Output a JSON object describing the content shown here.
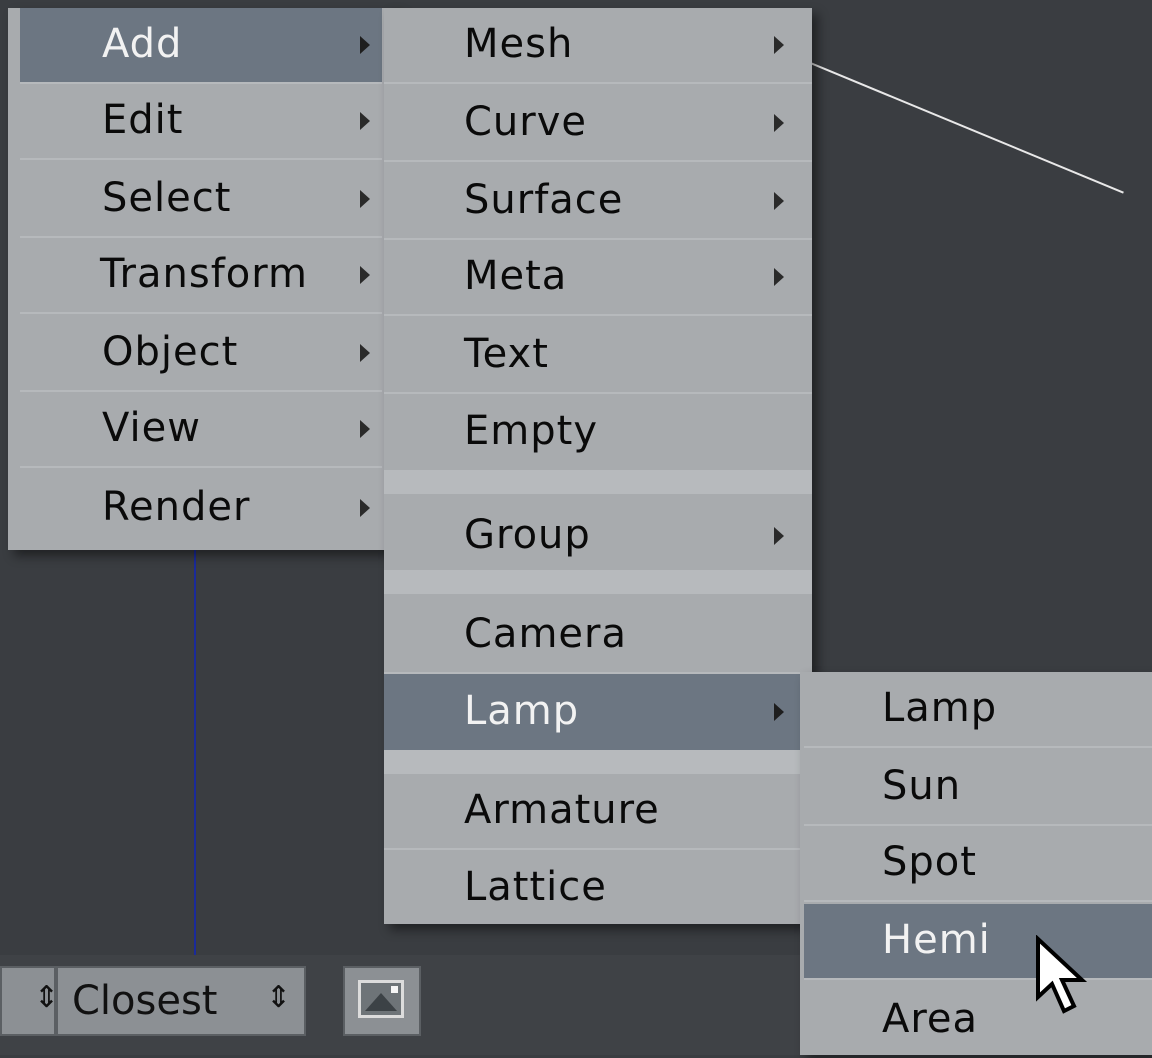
{
  "main_menu": {
    "items": [
      {
        "label": "Add",
        "has_submenu": true,
        "active": true
      },
      {
        "label": "Edit",
        "has_submenu": true
      },
      {
        "label": "Select",
        "has_submenu": true
      },
      {
        "label": "Transform",
        "has_submenu": true
      },
      {
        "label": "Object",
        "has_submenu": true
      },
      {
        "label": "View",
        "has_submenu": true
      },
      {
        "label": "Render",
        "has_submenu": true
      }
    ]
  },
  "add_menu": {
    "items": [
      {
        "label": "Mesh",
        "has_submenu": true
      },
      {
        "label": "Curve",
        "has_submenu": true
      },
      {
        "label": "Surface",
        "has_submenu": true
      },
      {
        "label": "Meta",
        "has_submenu": true
      },
      {
        "label": "Text"
      },
      {
        "label": "Empty"
      },
      {
        "label": "Group",
        "has_submenu": true
      },
      {
        "label": "Camera"
      },
      {
        "label": "Lamp",
        "has_submenu": true,
        "active": true
      },
      {
        "label": "Armature"
      },
      {
        "label": "Lattice"
      }
    ]
  },
  "lamp_menu": {
    "items": [
      {
        "label": "Lamp"
      },
      {
        "label": "Sun"
      },
      {
        "label": "Spot"
      },
      {
        "label": "Hemi",
        "active": true
      },
      {
        "label": "Area"
      }
    ]
  },
  "header": {
    "occlude_mode": {
      "value": "Closest"
    }
  },
  "colors": {
    "menu_bg": "#a8abae",
    "active_bg": "#6c7682",
    "viewport_bg": "#3a3d41"
  },
  "icons": {
    "render_button": "image-icon",
    "cursor": "mouse-pointer-icon"
  }
}
